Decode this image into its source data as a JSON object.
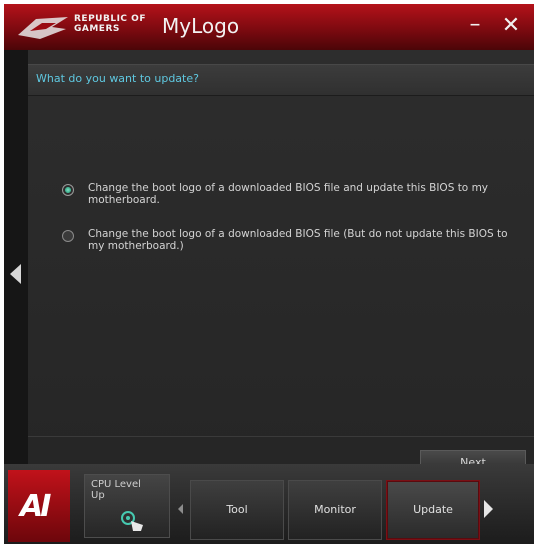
{
  "titlebar": {
    "brand_line1": "REPUBLIC OF",
    "brand_line2": "GAMERS",
    "app_title": "MyLogo",
    "minimize_glyph": "–",
    "close_glyph": "✕"
  },
  "main": {
    "question": "What do you want to update?",
    "options": [
      {
        "label": "Change the boot logo of a downloaded BIOS file and update this BIOS to my motherboard.",
        "selected": true
      },
      {
        "label": "Change the boot logo of a downloaded BIOS file (But do not update this BIOS to my motherboard.)",
        "selected": false
      }
    ],
    "next_label": "Next"
  },
  "bottombar": {
    "logo_text": "AI",
    "cpu_level_up_label": "CPU Level Up",
    "tabs": [
      {
        "label": "Tool",
        "active": false
      },
      {
        "label": "Monitor",
        "active": false
      },
      {
        "label": "Update",
        "active": true
      }
    ]
  },
  "colors": {
    "accent_red": "#b4121a",
    "question_text": "#5fc8e0",
    "radio_selected": "#3aa889"
  },
  "icons": [
    "rog-eye-icon",
    "minimize-icon",
    "close-icon",
    "left-arrow-icon",
    "radio-selected-icon",
    "radio-unselected-icon",
    "ai-suite-logo",
    "hand-pointer-icon",
    "right-arrow-icon"
  ]
}
